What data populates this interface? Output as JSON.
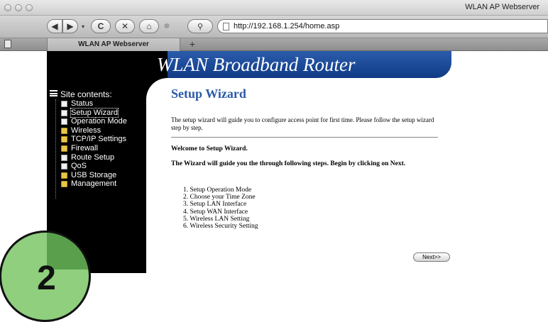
{
  "window": {
    "title": "WLAN AP Webserver"
  },
  "toolbar": {
    "url": "http://192.168.1.254/home.asp"
  },
  "tabs": [
    {
      "label": "WLAN AP Webserver"
    }
  ],
  "page": {
    "header_title": "WLAN Broadband Router",
    "sidebar": {
      "heading": "Site contents:",
      "items": [
        {
          "label": "Status",
          "icon": "document-icon"
        },
        {
          "label": "Setup Wizard",
          "icon": "document-icon"
        },
        {
          "label": "Operation Mode",
          "icon": "document-icon"
        },
        {
          "label": "Wireless",
          "icon": "folder-icon"
        },
        {
          "label": "TCP/IP Settings",
          "icon": "folder-icon"
        },
        {
          "label": "Firewall",
          "icon": "folder-icon"
        },
        {
          "label": "Route Setup",
          "icon": "document-icon"
        },
        {
          "label": "QoS",
          "icon": "document-icon"
        },
        {
          "label": "USB Storage",
          "icon": "folder-icon"
        },
        {
          "label": "Management",
          "icon": "folder-icon"
        }
      ]
    },
    "main": {
      "title": "Setup Wizard",
      "description": "The setup wizard will guide you to configure access point for first time. Please follow the setup wizard step by step.",
      "welcome": "Welcome to Setup Wizard.",
      "guide": "The Wizard will guide you the through following steps. Begin by clicking on Next.",
      "steps": [
        "1.  Setup Operation Mode",
        "2.  Choose your Time Zone",
        "3.  Setup LAN Interface",
        "4.  Setup WAN Interface",
        "5.  Wireless LAN Setting",
        "6.  Wireless Security Setting"
      ],
      "next_label": "Next>>"
    }
  },
  "badge": {
    "number": "2"
  },
  "colors": {
    "header_blue": "#1f4c9c",
    "title_blue": "#2a5aa8",
    "badge_green": "#8fcf7e"
  }
}
